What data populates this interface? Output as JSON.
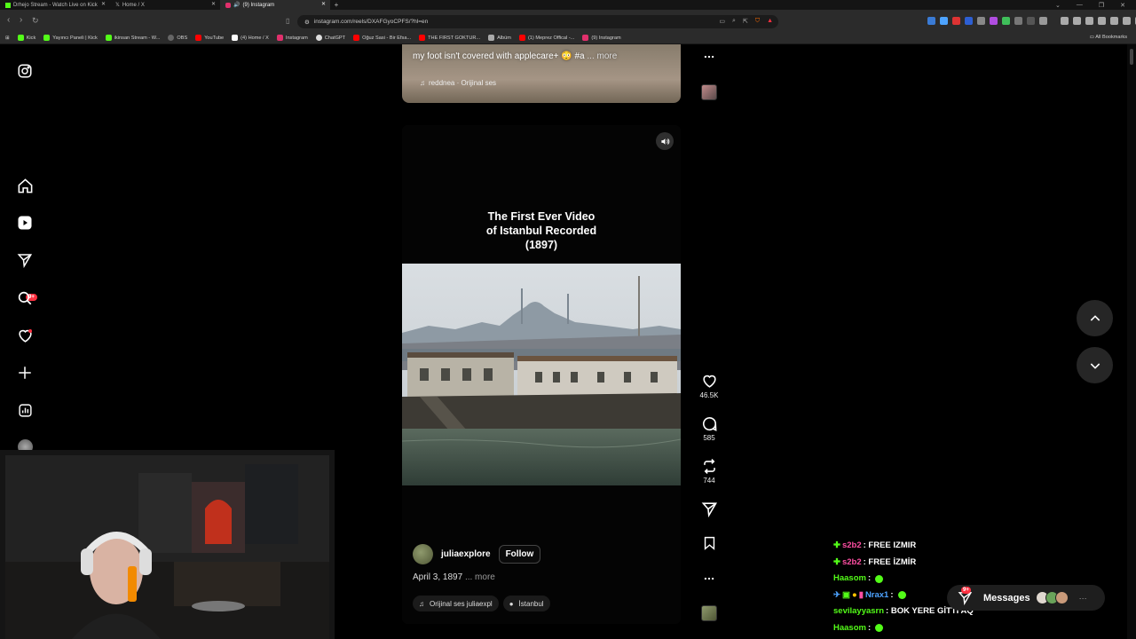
{
  "browser": {
    "tabs": [
      {
        "label": "Drhejo Stream - Watch Live on Kick",
        "color": "#53fc18"
      },
      {
        "label": "Home / X",
        "color": "#ffffff"
      },
      {
        "label": "(9) Instagram",
        "color": "#e1306c"
      }
    ],
    "url": "instagram.com/reels/DXAFGyoCPFS/?hl=en",
    "bookmarks": [
      {
        "label": "Kick",
        "color": "#53fc18"
      },
      {
        "label": "Yayıncı Paneli | Kick",
        "color": "#53fc18"
      },
      {
        "label": "ikinsan Stream - W...",
        "color": "#53fc18"
      },
      {
        "label": "OBS",
        "color": "#666666"
      },
      {
        "label": "YouTube",
        "color": "#ff0000"
      },
      {
        "label": "(4) Home / X",
        "color": "#ffffff"
      },
      {
        "label": "Instagram",
        "color": "#e1306c"
      },
      {
        "label": "ChatGPT",
        "color": "#dddddd"
      },
      {
        "label": "Oğuz Sasi - Bir Efsa...",
        "color": "#ff0000"
      },
      {
        "label": "THE FIRST GOKTUR...",
        "color": "#ff0000"
      },
      {
        "label": "Albüm",
        "color": "#aaaaaa"
      },
      {
        "label": "(1) Meprez Offical -...",
        "color": "#ff0000"
      },
      {
        "label": "(9) Instagram",
        "color": "#e1306c"
      }
    ],
    "all_bookmarks": "All Bookmarks"
  },
  "sidebar": {
    "notifications_badge": "9+"
  },
  "prev_reel": {
    "caption": "my foot isn't covered with applecare+ 😳 #a",
    "more": "... more",
    "audio": "reddnea · Orijinal ses"
  },
  "reel": {
    "title_line1": "The First Ever Video",
    "title_line2": "of Istanbul Recorded",
    "title_line3": "(1897)",
    "username": "juliaexplore",
    "follow": "Follow",
    "date": "April 3, 1897",
    "more": "... more",
    "audio": "Orijinal ses  juliaexpl",
    "location": "İstanbul"
  },
  "actions": {
    "likes": "46.5K",
    "comments": "585",
    "reposts": "744"
  },
  "chat": [
    {
      "user": "s2b2",
      "user_color": "#ff4fa3",
      "text": ": FREE IZMIR",
      "emote": false
    },
    {
      "user": "s2b2",
      "user_color": "#ff4fa3",
      "text": ": FREE İZMİR",
      "emote": false
    },
    {
      "user": "Haasom",
      "user_color": "#53fc18",
      "text": ":",
      "emote": true
    },
    {
      "user": "Nrax1",
      "user_color": "#4da3ff",
      "text": ":",
      "emote": true
    },
    {
      "user": "sevilayyasrn",
      "user_color": "#53fc18",
      "text": ": BOK YERE GİTTİ AQ",
      "emote": false
    },
    {
      "user": "Haasom",
      "user_color": "#53fc18",
      "text": ":",
      "emote": true
    }
  ],
  "messages": {
    "label": "Messages",
    "badge": "9+"
  },
  "colors": {
    "accent_red": "#ff3040",
    "kick_green": "#53fc18",
    "background": "#000000"
  }
}
